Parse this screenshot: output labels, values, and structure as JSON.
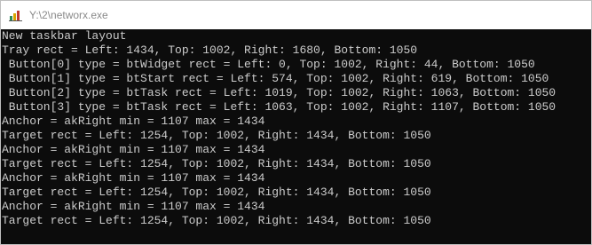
{
  "window": {
    "title": "Y:\\2\\networx.exe",
    "icon": "networx-app-icon",
    "background_color": "#0c0c0c",
    "text_color": "#cccccc"
  },
  "console": {
    "lines": [
      "New taskbar layout",
      "Tray rect = Left: 1434, Top: 1002, Right: 1680, Bottom: 1050",
      " Button[0] type = btWidget rect = Left: 0, Top: 1002, Right: 44, Bottom: 1050",
      " Button[1] type = btStart rect = Left: 574, Top: 1002, Right: 619, Bottom: 1050",
      " Button[2] type = btTask rect = Left: 1019, Top: 1002, Right: 1063, Bottom: 1050",
      " Button[3] type = btTask rect = Left: 1063, Top: 1002, Right: 1107, Bottom: 1050",
      "Anchor = akRight min = 1107 max = 1434",
      "Target rect = Left: 1254, Top: 1002, Right: 1434, Bottom: 1050",
      "Anchor = akRight min = 1107 max = 1434",
      "Target rect = Left: 1254, Top: 1002, Right: 1434, Bottom: 1050",
      "Anchor = akRight min = 1107 max = 1434",
      "Target rect = Left: 1254, Top: 1002, Right: 1434, Bottom: 1050",
      "Anchor = akRight min = 1107 max = 1434",
      "Target rect = Left: 1254, Top: 1002, Right: 1434, Bottom: 1050"
    ]
  }
}
